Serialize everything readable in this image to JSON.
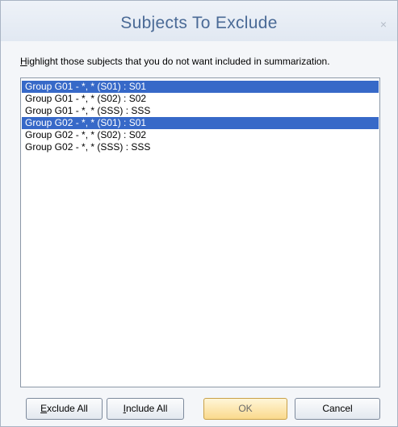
{
  "dialog": {
    "title": "Subjects To Exclude",
    "close_glyph": "×"
  },
  "instruction": {
    "first_letter": "H",
    "rest": "ighlight those subjects that you do not want included in summarization."
  },
  "list": {
    "items": [
      {
        "label": "Group G01 - *, * (S01) : S01",
        "selected": true
      },
      {
        "label": "Group G01 - *, * (S02) : S02",
        "selected": false
      },
      {
        "label": "Group G01 - *, * (SSS) : SSS",
        "selected": false
      },
      {
        "label": "Group G02 - *, * (S01) : S01",
        "selected": true
      },
      {
        "label": "Group G02 - *, * (S02) : S02",
        "selected": false
      },
      {
        "label": "Group G02 - *, * (SSS) : SSS",
        "selected": false
      }
    ]
  },
  "buttons": {
    "exclude_all": {
      "mnemonic": "E",
      "rest": "xclude All"
    },
    "include_all": {
      "mnemonic": "I",
      "rest": "nclude All"
    },
    "ok": "OK",
    "cancel": "Cancel"
  },
  "colors": {
    "selection": "#3769c8",
    "title_text": "#4a6a96",
    "ok_button": "#fad98c"
  }
}
